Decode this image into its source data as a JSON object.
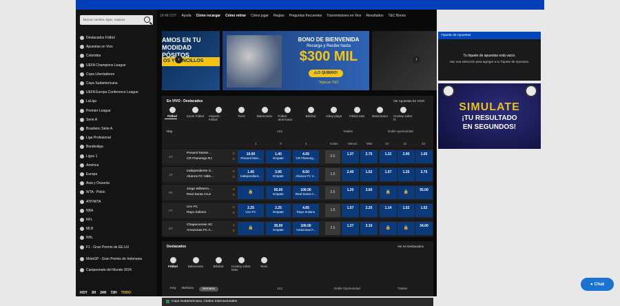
{
  "header": {
    "time": "18:48 COT",
    "nav": [
      "Ayuda",
      "Cómo recargar",
      "Cómo retirar",
      "Cómo jugar",
      "Reglas",
      "Preguntas frecuentes",
      "Transmisiones en Vivo",
      "Resultados",
      "T&C Bonos"
    ]
  },
  "sidebar": {
    "search_placeholder": "Buscar nombre, ligas, equipos",
    "items": [
      "Destacados Fútbol",
      "Apuestas en Vivo",
      "Colombia",
      "UEFA Champions League",
      "Copa Libertadores",
      "Copa Sudamericana",
      "UEFA Europa Conference League",
      "LaLiga",
      "Premier League",
      "Serie A",
      "Brasileiro Série A",
      "Liga Profesional",
      "Bundesliga",
      "Ligue 1",
      "América",
      "Europa",
      "Asia y Oceanía",
      "WTA - Pekín",
      "ATP/WTA",
      "NBA",
      "NFL",
      "MLB",
      "NHL",
      "F1 - Gran Premio de EE.UU",
      "MotoGP - Gran Premio de Indonesia",
      "Campeonato del Mundo 2024"
    ],
    "footer": [
      "HOY",
      "3H",
      "24H",
      "72H",
      "TODO"
    ]
  },
  "banners": {
    "b1_text": "AMOS EN TU\nMODIDAD\nPÓSITOS",
    "b1_sub": "OS Y SENCILLOS",
    "b2_head": "BONO DE BIENVENIDA",
    "b2_sub": "Recarga y Recibe hasta",
    "b2_amount": "$300 MIL",
    "b2_cta": "¡LO QUIERO!",
    "b2_tc": "*Aplican T&C"
  },
  "live": {
    "title": "En VIVO - Destacados",
    "link": "Ver Apuestas En VIVO",
    "sports": [
      "Fútbol",
      "Zoom Fútbol",
      "eSports - Fútbol",
      "Tenis",
      "Baloncesto",
      "Fútbol americano",
      "Béisbol",
      "Voley-playa",
      "Fútbol sala",
      "Balonmano",
      "Hockey sobre hi"
    ],
    "col_hoy": "Hoy",
    "col_1x2": "1X2",
    "col_totales": "Totales",
    "col_doble": "Doble oportunidad",
    "sub": [
      "1",
      "X",
      "2",
      "Goles",
      "Menos",
      "Más",
      "1X",
      "12",
      "X2"
    ],
    "rows": [
      {
        "min": "33'",
        "t1": "Penarol Monte...",
        "t2": "CR Flamengo RJ",
        "s1": "0",
        "s2": "0",
        "o1": "10.00",
        "l1": "Penarol Mon...",
        "ox": "1.40",
        "lx": "Empate",
        "o2": "4.05",
        "l2": "CR Flameng...",
        "g": "0.5",
        "me": "1.37",
        "ma": "2.75",
        "d1": "1.22",
        "d2": "2.90",
        "d3": "1.05",
        "lock": []
      },
      {
        "min": "16'",
        "t1": "Independiente S...",
        "t2": "Alianza FC Valle...",
        "s1": "0",
        "s2": "0",
        "o1": "1.45",
        "l1": "Independient...",
        "ox": "3.95",
        "lx": "Empate",
        "o2": "8.50",
        "l2": "Alianza FC V...",
        "g": "1.5",
        "me": "2.40",
        "ma": "1.52",
        "d1": "1.07",
        "d2": "1.25",
        "d3": "2.75",
        "lock": []
      },
      {
        "min": "88'",
        "t1": "Jorge Wilsterm...",
        "t2": "Real Santa Cruz",
        "s1": "2",
        "s2": "0",
        "o1": "",
        "l1": "",
        "ox": "55.00",
        "lx": "Empate",
        "o2": "100.00",
        "l2": "Real Santa C...",
        "g": "2.5",
        "me": "1.20",
        "ma": "3.60",
        "d1": "",
        "d2": "",
        "d3": "55.00",
        "lock": [
          "o1",
          "d1",
          "d2"
        ]
      },
      {
        "min": "HT",
        "t1": "Ucv FC",
        "t2": "Rayo Zuliano",
        "s1": "0",
        "s2": "0",
        "o1": "2.25",
        "l1": "Ucv FC",
        "ox": "2.25",
        "lx": "Empate",
        "o2": "4.65",
        "l2": "Rayo Zuliano",
        "g": "1.5",
        "me": "1.57",
        "ma": "2.25",
        "d1": "1.14",
        "d2": "1.52",
        "d3": "1.52",
        "lock": []
      },
      {
        "min": "83'",
        "t1": "Chapecoense SC",
        "t2": "Amazonas FC A...",
        "s1": "1",
        "s2": "0",
        "o1": "",
        "l1": "",
        "ox": "35.00",
        "lx": "Empate",
        "o2": "100.00",
        "l2": "Amazonas F...",
        "g": "2.5",
        "me": "1.27",
        "ma": "3.15",
        "d1": "",
        "d2": "",
        "d3": "34.00",
        "lock": [
          "o1",
          "d1",
          "d2"
        ]
      }
    ]
  },
  "featured": {
    "title": "Destacados",
    "link": "Ver en Destacados",
    "sports": [
      "Fútbol",
      "Baloncesto",
      "Béisbol",
      "Hockey sobre hielo",
      "Tenis"
    ],
    "tabs": [
      "Hoy",
      "Mañana",
      "Semana"
    ],
    "col_1x2": "1X2",
    "col_doble": "Doble Oportunidad",
    "col_totales": "Totales",
    "league": "Copa Sudamericana, Clubes Internacionales"
  },
  "ticket": {
    "title": "Tiquete de Apuestas",
    "empty": "Tu tiquete de apuestas está vacío.",
    "hint": "Haz una selección para agregar a tu Tiquete de Apuestas."
  },
  "promo": {
    "l1": "SIMULATE",
    "l2": "¡TU RESULTADO",
    "l3": "EN SEGUNDOS!"
  },
  "chat": "Chat",
  "colors": {
    "brand": "#003fb8",
    "odds": "#0b3a7a",
    "score": "#f08a00",
    "promo_yellow": "#f4c418"
  }
}
